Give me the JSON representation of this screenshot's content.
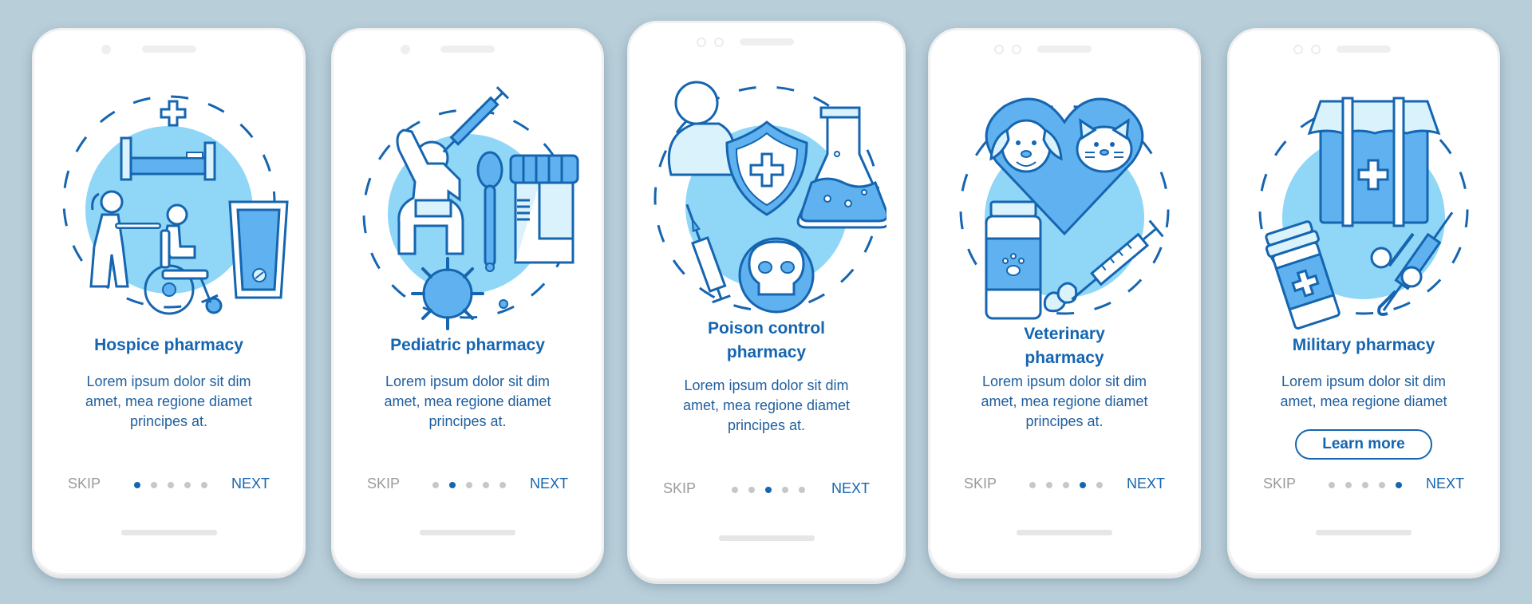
{
  "colors": {
    "background": "#b8ced9",
    "accent": "#1565b0",
    "illustration_light": "#8fd6f7",
    "illustration_mid": "#5fb2ef",
    "dot_inactive": "#c7c7c7",
    "skip_gray": "#9a9a9a"
  },
  "screens": [
    {
      "title": "Hospice pharmacy",
      "illustration": "hospice-illustration",
      "description_lines": [
        "Lorem ipsum dolor sit dim",
        "amet, mea regione diamet",
        "principes at."
      ],
      "skip_label": "SKIP",
      "next_label": "NEXT",
      "active_step": 1,
      "total_steps": 5
    },
    {
      "title": "Pediatric pharmacy",
      "illustration": "pediatric-illustration",
      "description_lines": [
        "Lorem ipsum dolor sit dim",
        "amet, mea regione diamet",
        "principes at."
      ],
      "skip_label": "SKIP",
      "next_label": "NEXT",
      "active_step": 2,
      "total_steps": 5
    },
    {
      "title_lines": [
        "Poison control",
        "pharmacy"
      ],
      "illustration": "poison-control-illustration",
      "description_lines": [
        "Lorem ipsum dolor sit dim",
        "amet, mea regione diamet",
        "principes at."
      ],
      "skip_label": "SKIP",
      "next_label": "NEXT",
      "active_step": 3,
      "total_steps": 5
    },
    {
      "title_lines": [
        "Veterinary",
        "pharmacy"
      ],
      "illustration": "veterinary-illustration",
      "description_lines": [
        "Lorem ipsum dolor sit dim",
        "amet, mea regione diamet",
        "principes at."
      ],
      "skip_label": "SKIP",
      "next_label": "NEXT",
      "active_step": 4,
      "total_steps": 5
    },
    {
      "title": "Military pharmacy",
      "illustration": "military-illustration",
      "description_lines": [
        "Lorem ipsum dolor sit dim",
        "amet, mea regione diamet"
      ],
      "button_label": "Learn more",
      "skip_label": "SKIP",
      "next_label": "NEXT",
      "active_step": 5,
      "total_steps": 5
    }
  ]
}
